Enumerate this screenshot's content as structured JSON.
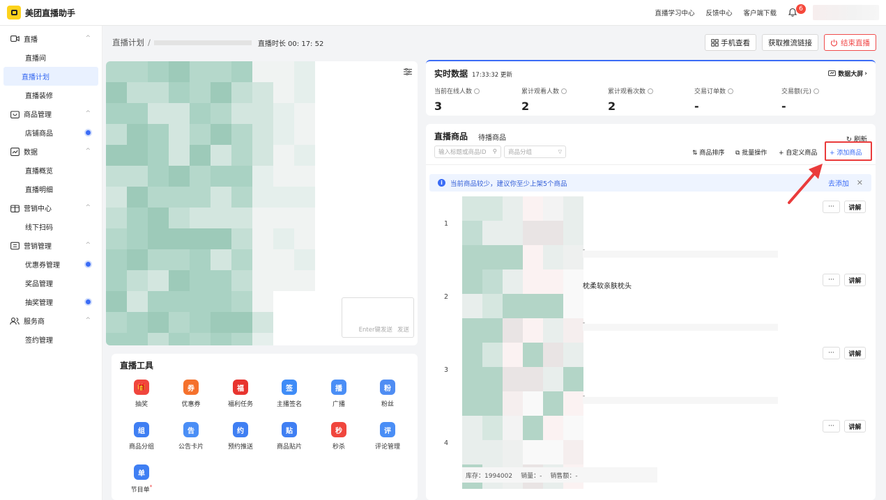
{
  "app": {
    "name": "美团直播助手"
  },
  "topnav": {
    "links": [
      "直播学习中心",
      "反馈中心",
      "客户端下载"
    ],
    "notification_count": "6"
  },
  "sidebar": {
    "groups": [
      {
        "label": "直播",
        "icon": "video-icon",
        "items": [
          {
            "label": "直播间",
            "active": false,
            "dot": false
          },
          {
            "label": "直播计划",
            "active": true,
            "dot": false
          },
          {
            "label": "直播装修",
            "active": false,
            "dot": false
          }
        ]
      },
      {
        "label": "商品管理",
        "icon": "bag-icon",
        "items": [
          {
            "label": "店铺商品",
            "active": false,
            "dot": true
          }
        ]
      },
      {
        "label": "数据",
        "icon": "chart-icon",
        "items": [
          {
            "label": "直播概览",
            "active": false,
            "dot": false
          },
          {
            "label": "直播明细",
            "active": false,
            "dot": false
          }
        ]
      },
      {
        "label": "营销中心",
        "icon": "gift-box-icon",
        "items": [
          {
            "label": "线下扫码",
            "active": false,
            "dot": false
          }
        ]
      },
      {
        "label": "营销管理",
        "icon": "coupon-icon",
        "items": [
          {
            "label": "优惠券管理",
            "active": false,
            "dot": true
          },
          {
            "label": "奖品管理",
            "active": false,
            "dot": false
          },
          {
            "label": "抽奖管理",
            "active": false,
            "dot": true
          }
        ]
      },
      {
        "label": "服务商",
        "icon": "users-icon",
        "items": [
          {
            "label": "签约管理",
            "active": false,
            "dot": false
          }
        ]
      }
    ]
  },
  "header": {
    "breadcrumb": "直播计划",
    "separator": "/",
    "duration": "直播时长 00: 17: 52",
    "buttons": {
      "phone": "手机查看",
      "stream": "获取推流链接",
      "end": "结束直播"
    }
  },
  "chat": {
    "hint": "Enter键发送",
    "send": "发送"
  },
  "tools": {
    "title": "直播工具",
    "items": [
      {
        "label": "抽奖",
        "color": "#f0463d",
        "glyph": "🎁",
        "star": false
      },
      {
        "label": "优惠券",
        "color": "#f5712c",
        "glyph": "券",
        "star": false
      },
      {
        "label": "福利任务",
        "color": "#e8342f",
        "glyph": "福",
        "star": false
      },
      {
        "label": "主播签名",
        "color": "#3f8cf7",
        "glyph": "签",
        "star": false
      },
      {
        "label": "广播",
        "color": "#4a8ef6",
        "glyph": "播",
        "star": false
      },
      {
        "label": "粉丝",
        "color": "#4f8df3",
        "glyph": "粉",
        "star": false
      },
      {
        "label": "商品分组",
        "color": "#3f7ff3",
        "glyph": "组",
        "star": false
      },
      {
        "label": "公告卡片",
        "color": "#4a8ef6",
        "glyph": "告",
        "star": false
      },
      {
        "label": "预约推送",
        "color": "#3f7ff3",
        "glyph": "约",
        "star": false
      },
      {
        "label": "商品贴片",
        "color": "#3f7ff3",
        "glyph": "贴",
        "star": false
      },
      {
        "label": "秒杀",
        "color": "#f0463d",
        "glyph": "秒",
        "star": false
      },
      {
        "label": "评论管理",
        "color": "#4a8ef6",
        "glyph": "评",
        "star": false
      },
      {
        "label": "节目单",
        "color": "#3f7ff3",
        "glyph": "单",
        "star": true
      }
    ]
  },
  "realtime": {
    "title": "实时数据",
    "updated": "17:33:32 更新",
    "dashboard": "数据大屏",
    "stats": [
      {
        "label": "当前在线人数",
        "value": "3"
      },
      {
        "label": "累计观看人数",
        "value": "2"
      },
      {
        "label": "累计观看次数",
        "value": "2"
      },
      {
        "label": "交易订单数",
        "value": "-"
      },
      {
        "label": "交易额(元)",
        "value": "-"
      }
    ]
  },
  "products": {
    "title": "直播商品",
    "tab2": "待播商品",
    "refresh": "刷新",
    "search_placeholder": "输入标题或商品ID",
    "group_placeholder": "商品分组",
    "actions": {
      "sort": "商品排序",
      "batch": "批量操作",
      "custom": "自定义商品",
      "add": "添加商品"
    },
    "notice": {
      "text": "当前商品较少，建议你至少上架5个商品",
      "add": "去添加"
    },
    "rows": [
      {
        "index": "1",
        "name": "",
        "more": "···",
        "explain": "讲解",
        "dash": "-"
      },
      {
        "index": "2",
        "name": "枕柔软亲肤枕头",
        "more": "···",
        "explain": "讲解",
        "dash": "-"
      },
      {
        "index": "3",
        "name": "",
        "more": "···",
        "explain": "讲解",
        "dash": "-"
      },
      {
        "index": "4",
        "name": "",
        "more": "···",
        "explain": "讲解",
        "dash": ""
      }
    ],
    "footer": {
      "stock": "库存：1994002",
      "sales": "销量：-",
      "amount": "销售额：-"
    }
  },
  "colors": {
    "accent": "#3b6cf6",
    "danger": "#ea3b3b",
    "brand": "#fdd21c"
  }
}
